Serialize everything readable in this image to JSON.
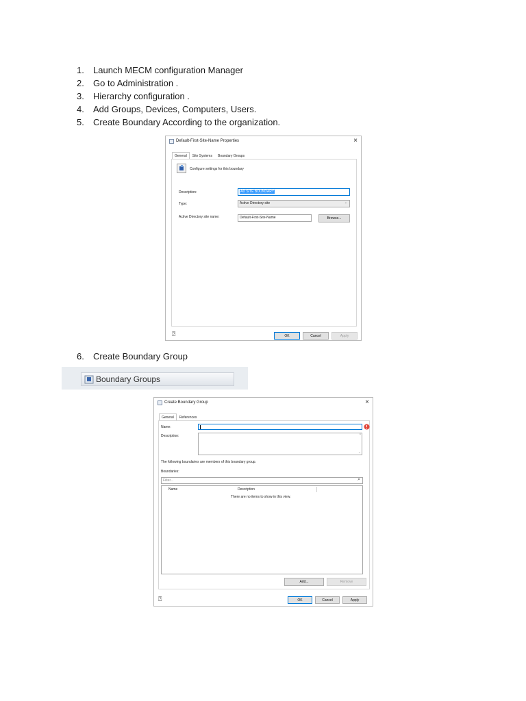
{
  "steps": [
    {
      "num": "1.",
      "text": "Launch MECM configuration Manager"
    },
    {
      "num": "2.",
      "text": "Go to Administration ."
    },
    {
      "num": "3.",
      "text": "Hierarchy configuration ."
    },
    {
      "num": "4.",
      "text": "Add Groups, Devices, Computers, Users."
    },
    {
      "num": "5.",
      "text": "Create Boundary According to the organization."
    }
  ],
  "step6": {
    "num": "6.",
    "text": "Create Boundary Group"
  },
  "props_dialog": {
    "title": "Default-First-Site-Name Properties",
    "close": "×",
    "tabs": [
      "General",
      "Site Systems",
      "Boundary Groups"
    ],
    "header_text": "Configure settings for this boundary",
    "description_label": "Description:",
    "description_value": "AD SITE BOUNDARY",
    "type_label": "Type:",
    "type_value": "Active Directory site",
    "ad_site_label": "Active Directory site name:",
    "ad_site_value": "Default-First-Site-Name",
    "browse": "Browse...",
    "ok": "OK",
    "cancel": "Cancel",
    "apply": "Apply"
  },
  "boundary_groups_node": {
    "label": "Boundary Groups"
  },
  "create_dialog": {
    "title": "Create Boundary Group",
    "close": "×",
    "tabs": [
      "General",
      "References"
    ],
    "name_label": "Name:",
    "name_value": "",
    "description_label": "Description:",
    "members_text": "The following boundaries are members of this boundary group.",
    "boundaries_label": "Boundaries:",
    "filter_placeholder": "Filter...",
    "col_name": "Name",
    "col_description": "Description",
    "empty_text": "There are no items to show in this view.",
    "add": "Add...",
    "remove": "Remove",
    "ok": "OK",
    "cancel": "Cancel",
    "apply": "Apply"
  },
  "colors": {
    "accent": "#0078d7",
    "selection": "#3399ff",
    "error": "#e0463b"
  }
}
